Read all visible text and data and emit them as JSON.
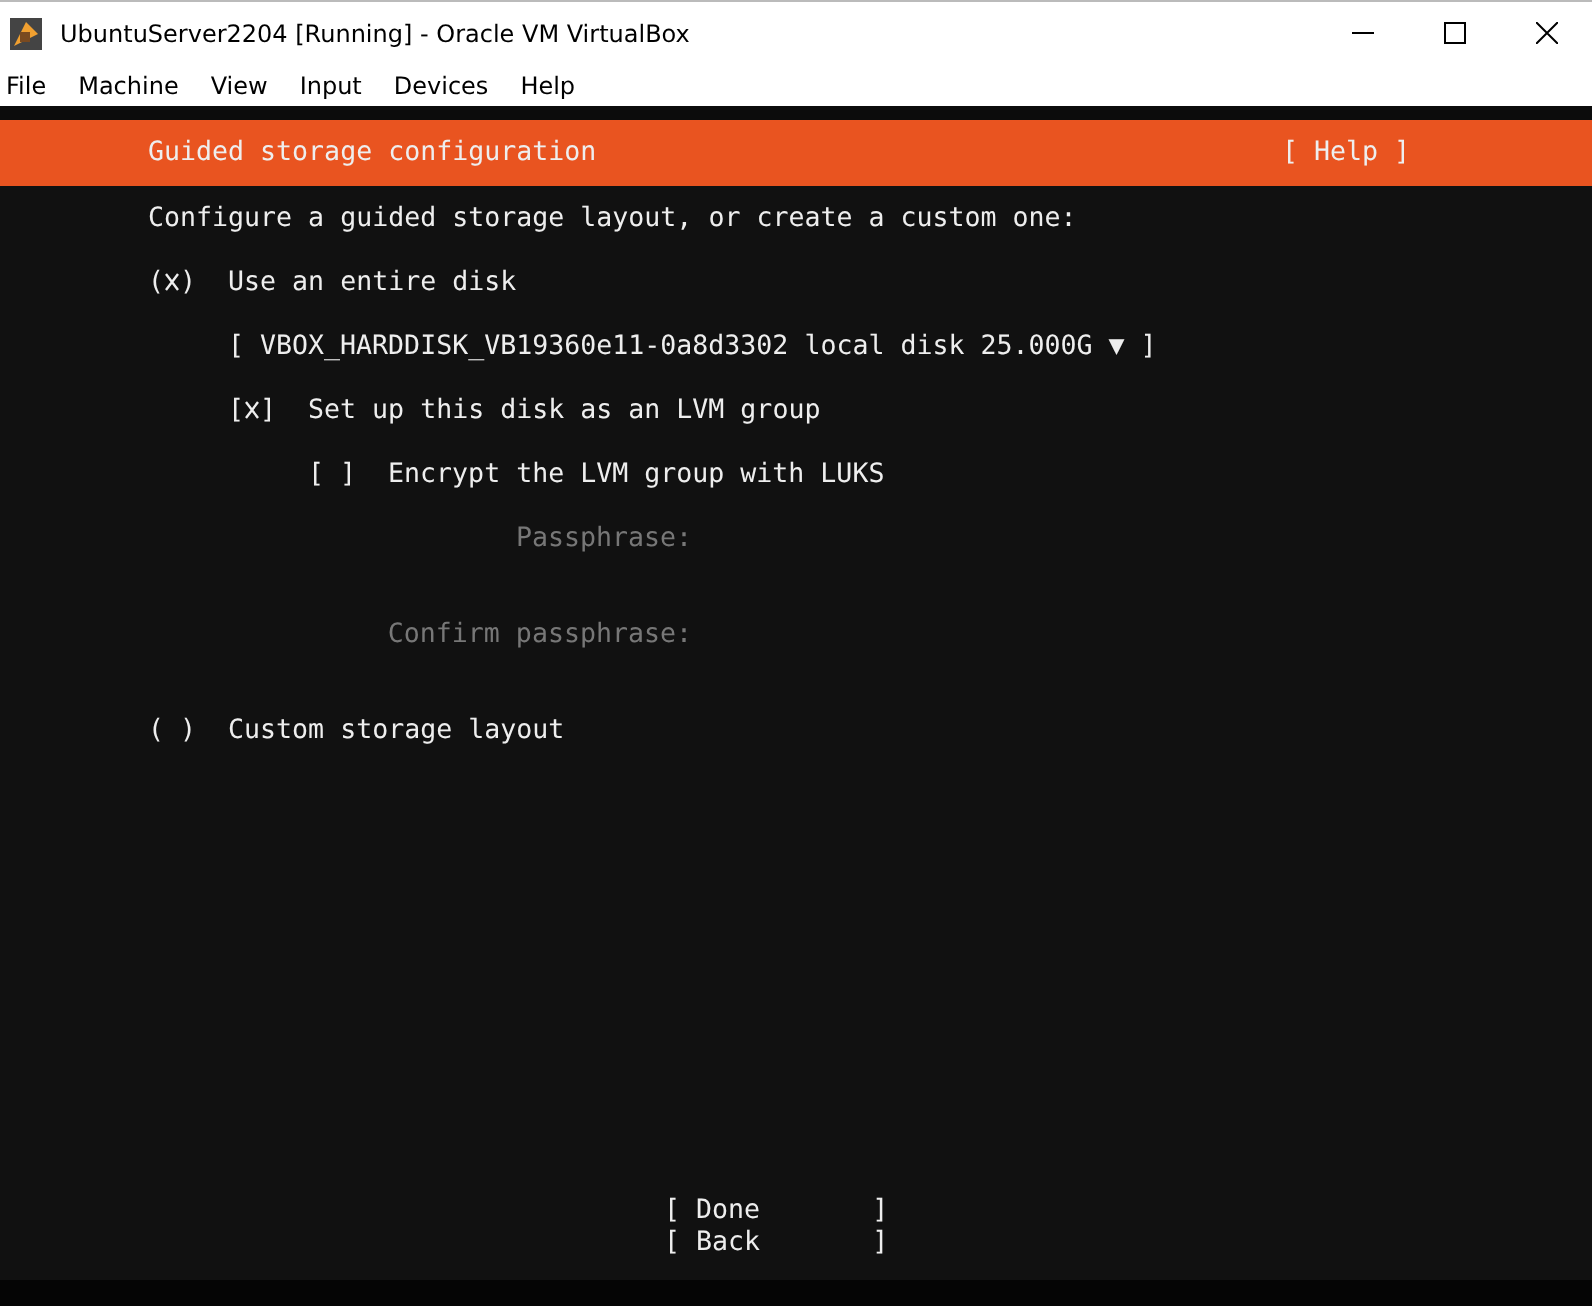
{
  "window": {
    "title": "UbuntuServer2204 [Running] - Oracle VM VirtualBox"
  },
  "menu": [
    "File",
    "Machine",
    "View",
    "Input",
    "Devices",
    "Help"
  ],
  "header": {
    "title": "Guided storage configuration",
    "help": "[ Help ]"
  },
  "intro": "Configure a guided storage layout, or create a custom one:",
  "options": [
    {
      "kind": "radio",
      "brackets": [
        "(",
        ")"
      ],
      "selected": true,
      "label": "Use an entire disk",
      "children": [
        {
          "kind": "dropdown",
          "label": "[ VBOX_HARDDISK_VB19360e11-0a8d3302 local disk 25.000G ▼ ]"
        },
        {
          "kind": "checkbox",
          "brackets": [
            "[",
            "]"
          ],
          "checked": true,
          "label": "Set up this disk as an LVM group",
          "children": [
            {
              "kind": "checkbox",
              "brackets": [
                "[",
                "]"
              ],
              "checked": false,
              "label": "Encrypt the LVM group with LUKS"
            },
            {
              "kind": "field",
              "label": "Passphrase:",
              "disabled": true
            },
            {
              "kind": "field",
              "label": "Confirm passphrase:",
              "disabled": true
            }
          ]
        }
      ]
    },
    {
      "kind": "radio",
      "brackets": [
        "(",
        ")"
      ],
      "selected": false,
      "label": "Custom storage layout"
    }
  ],
  "buttons": [
    "[ Done       ]",
    "[ Back       ]"
  ]
}
